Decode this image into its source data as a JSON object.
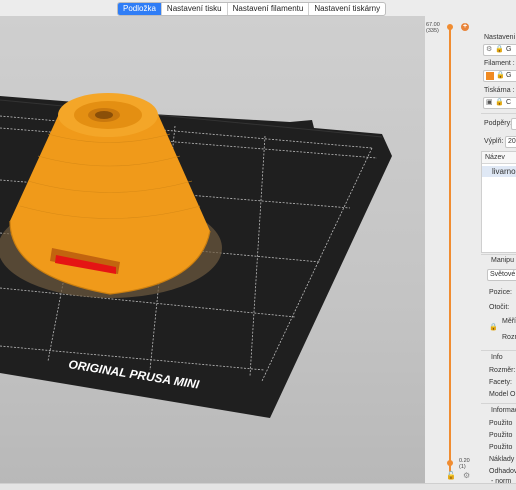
{
  "tabs": [
    {
      "label": "Podložka",
      "active": true
    },
    {
      "label": "Nastavení tisku",
      "active": false
    },
    {
      "label": "Nastavení filamentu",
      "active": false
    },
    {
      "label": "Nastavení tiskárny",
      "active": false
    }
  ],
  "bed": {
    "label": "ORIGINAL PRUSA MINI",
    "bed_color": "#1f1f1f",
    "model_color": "#f09a1a",
    "accent_color": "#ee8a2f"
  },
  "layer_slider": {
    "top_height": "67.00",
    "top_layer": "(335)",
    "bottom_height": "0.20",
    "bottom_layer": "(1)"
  },
  "sidebar": {
    "print_settings_label": "Nastaveni",
    "print_settings_value": "G",
    "filament_label": "Filament :",
    "filament_value": "G",
    "filament_color": "#f08a22",
    "printer_label": "Tiskárna :",
    "printer_value": "C",
    "supports_label": "Podpěry:",
    "infill_label": "Výplň:",
    "infill_value": "20",
    "name_header": "Název",
    "object_name": "livarno",
    "manipulation_header": "Manipu",
    "coord_mode": "Světové",
    "position_label": "Pozice:",
    "rotation_label": "Otočit:",
    "scale_label": "Měřít",
    "size_label": "Rozm",
    "info_header": "Info",
    "size_info_label": "Rozměr:",
    "facets_label": "Facety:",
    "model_label": "Model O",
    "sliced_info_header": "Informac",
    "used_1": "Použito",
    "used_2": "Použito",
    "used_3": "Použito",
    "cost_label": "Náklady",
    "estimated_label": "Odhadov",
    "normal_mode_label": "- norm"
  }
}
